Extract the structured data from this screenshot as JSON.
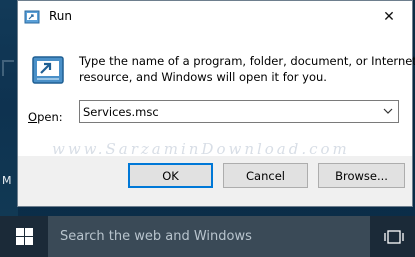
{
  "window": {
    "title": "Run",
    "close_glyph": "✕"
  },
  "dialog": {
    "description_line1": "Type the name of a program, folder, document, or Internet",
    "description_line2": "resource, and Windows will open it for you.",
    "open_label_accel": "O",
    "open_label_rest": "pen:",
    "open_value": "Services.msc",
    "watermark": "www.SarzaminDownload.com"
  },
  "buttons": {
    "ok": "OK",
    "cancel": "Cancel",
    "browse": "Browse..."
  },
  "taskbar": {
    "search_placeholder": "Search the web and Windows"
  },
  "desktop": {
    "edge_letter": "M"
  },
  "colors": {
    "accent": "#0078d7",
    "taskbar": "#1b2a38",
    "search_box": "#3a4a57",
    "dialog_bg": "#f0f0f0"
  },
  "icons": [
    "run-icon",
    "close-icon",
    "dropdown-arrow-icon",
    "windows-logo-icon",
    "task-view-icon"
  ]
}
